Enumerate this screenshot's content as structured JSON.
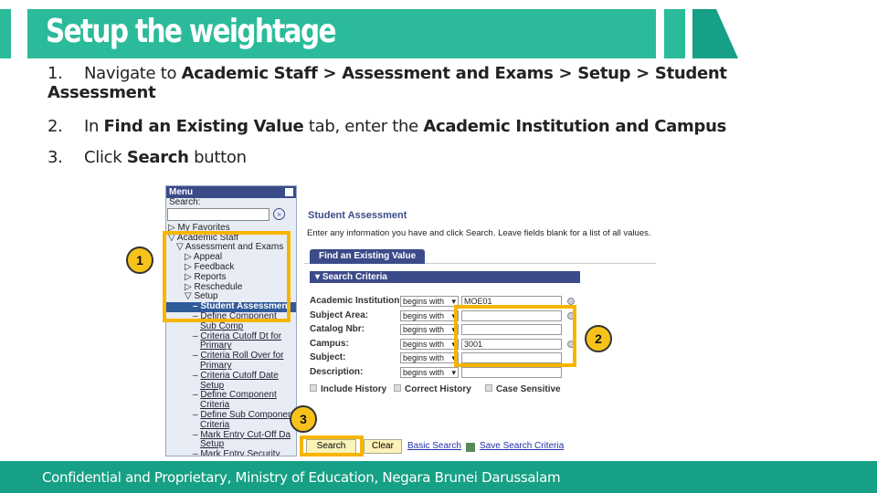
{
  "title": "Setup the weightage",
  "colors": {
    "accent": "#2bbb9a",
    "accent_dark": "#16a085",
    "highlight": "#f7b500"
  },
  "steps": [
    {
      "num": "1.",
      "parts": [
        "Navigate to ",
        "Academic Staff > Assessment and Exams > Setup > Student Assessment"
      ]
    },
    {
      "num": "2.",
      "parts": [
        "In ",
        "Find an Existing Value",
        " tab, enter the ",
        "Academic Institution and Campus"
      ]
    },
    {
      "num": "3.",
      "parts": [
        "Click ",
        "Search",
        " button"
      ]
    }
  ],
  "sidebar": {
    "header": "Menu",
    "search_label": "Search:",
    "items": [
      "My Favorites",
      "Academic Staff",
      "Assessment and Exams",
      "Appeal",
      "Feedback",
      "Reports",
      "Reschedule",
      "Setup",
      "Student Assessment",
      "Define Component",
      "Sub Comp",
      "Criteria Cutoff Dt for",
      "Primary",
      "Criteria Roll Over for",
      "Primary",
      "Criteria Cutoff Date",
      "Setup",
      "Define Component",
      "Criteria",
      "Define Sub Componen",
      "Criteria",
      "Mark Entry Cut-Off Da",
      "Setup",
      "Mark Entry Security"
    ]
  },
  "main": {
    "page_title": "Student Assessment",
    "instructions": "Enter any information you have and click Search. Leave fields blank for a list of all values.",
    "tab": "Find an Existing Value",
    "section": "Search Criteria",
    "fields": [
      {
        "label": "Academic Institution:",
        "op": "begins with",
        "value": "MOE01",
        "lookup": true
      },
      {
        "label": "Subject Area:",
        "op": "begins with",
        "value": "",
        "lookup": true
      },
      {
        "label": "Catalog Nbr:",
        "op": "begins with",
        "value": "",
        "lookup": false
      },
      {
        "label": "Campus:",
        "op": "begins with",
        "value": "3001",
        "lookup": true
      },
      {
        "label": "Subject:",
        "op": "begins with",
        "value": "",
        "lookup": false
      },
      {
        "label": "Description:",
        "op": "begins with",
        "value": "",
        "lookup": false
      }
    ],
    "checkboxes": [
      "Include History",
      "Correct History",
      "Case Sensitive"
    ],
    "search_button": "Search",
    "clear_button": "Clear",
    "basic_search": "Basic Search",
    "save_search": "Save Search Criteria"
  },
  "badges": [
    "1",
    "2",
    "3"
  ],
  "footer": "Confidential and Proprietary, Ministry of Education, Negara Brunei Darussalam"
}
